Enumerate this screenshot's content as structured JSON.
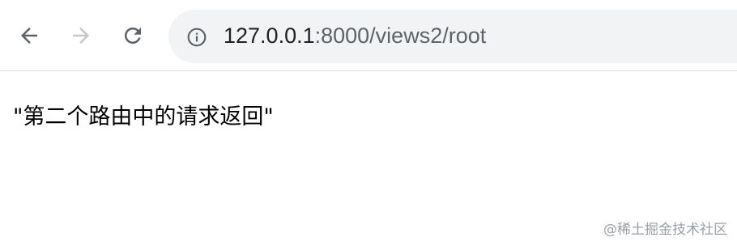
{
  "browser": {
    "url": {
      "host": "127.0.0.1",
      "path": ":8000/views2/root"
    },
    "icons": {
      "back": "arrow-left-icon",
      "forward": "arrow-right-icon",
      "reload": "reload-icon",
      "site_info": "info-circle-icon"
    },
    "colors": {
      "omnibox_bg": "#f1f3f4",
      "icon_active": "#5f6368",
      "icon_disabled": "#c4c7c5"
    }
  },
  "page": {
    "response_text": "\"第二个路由中的请求返回\""
  },
  "watermark": {
    "text": "@稀土掘金技术社区"
  }
}
